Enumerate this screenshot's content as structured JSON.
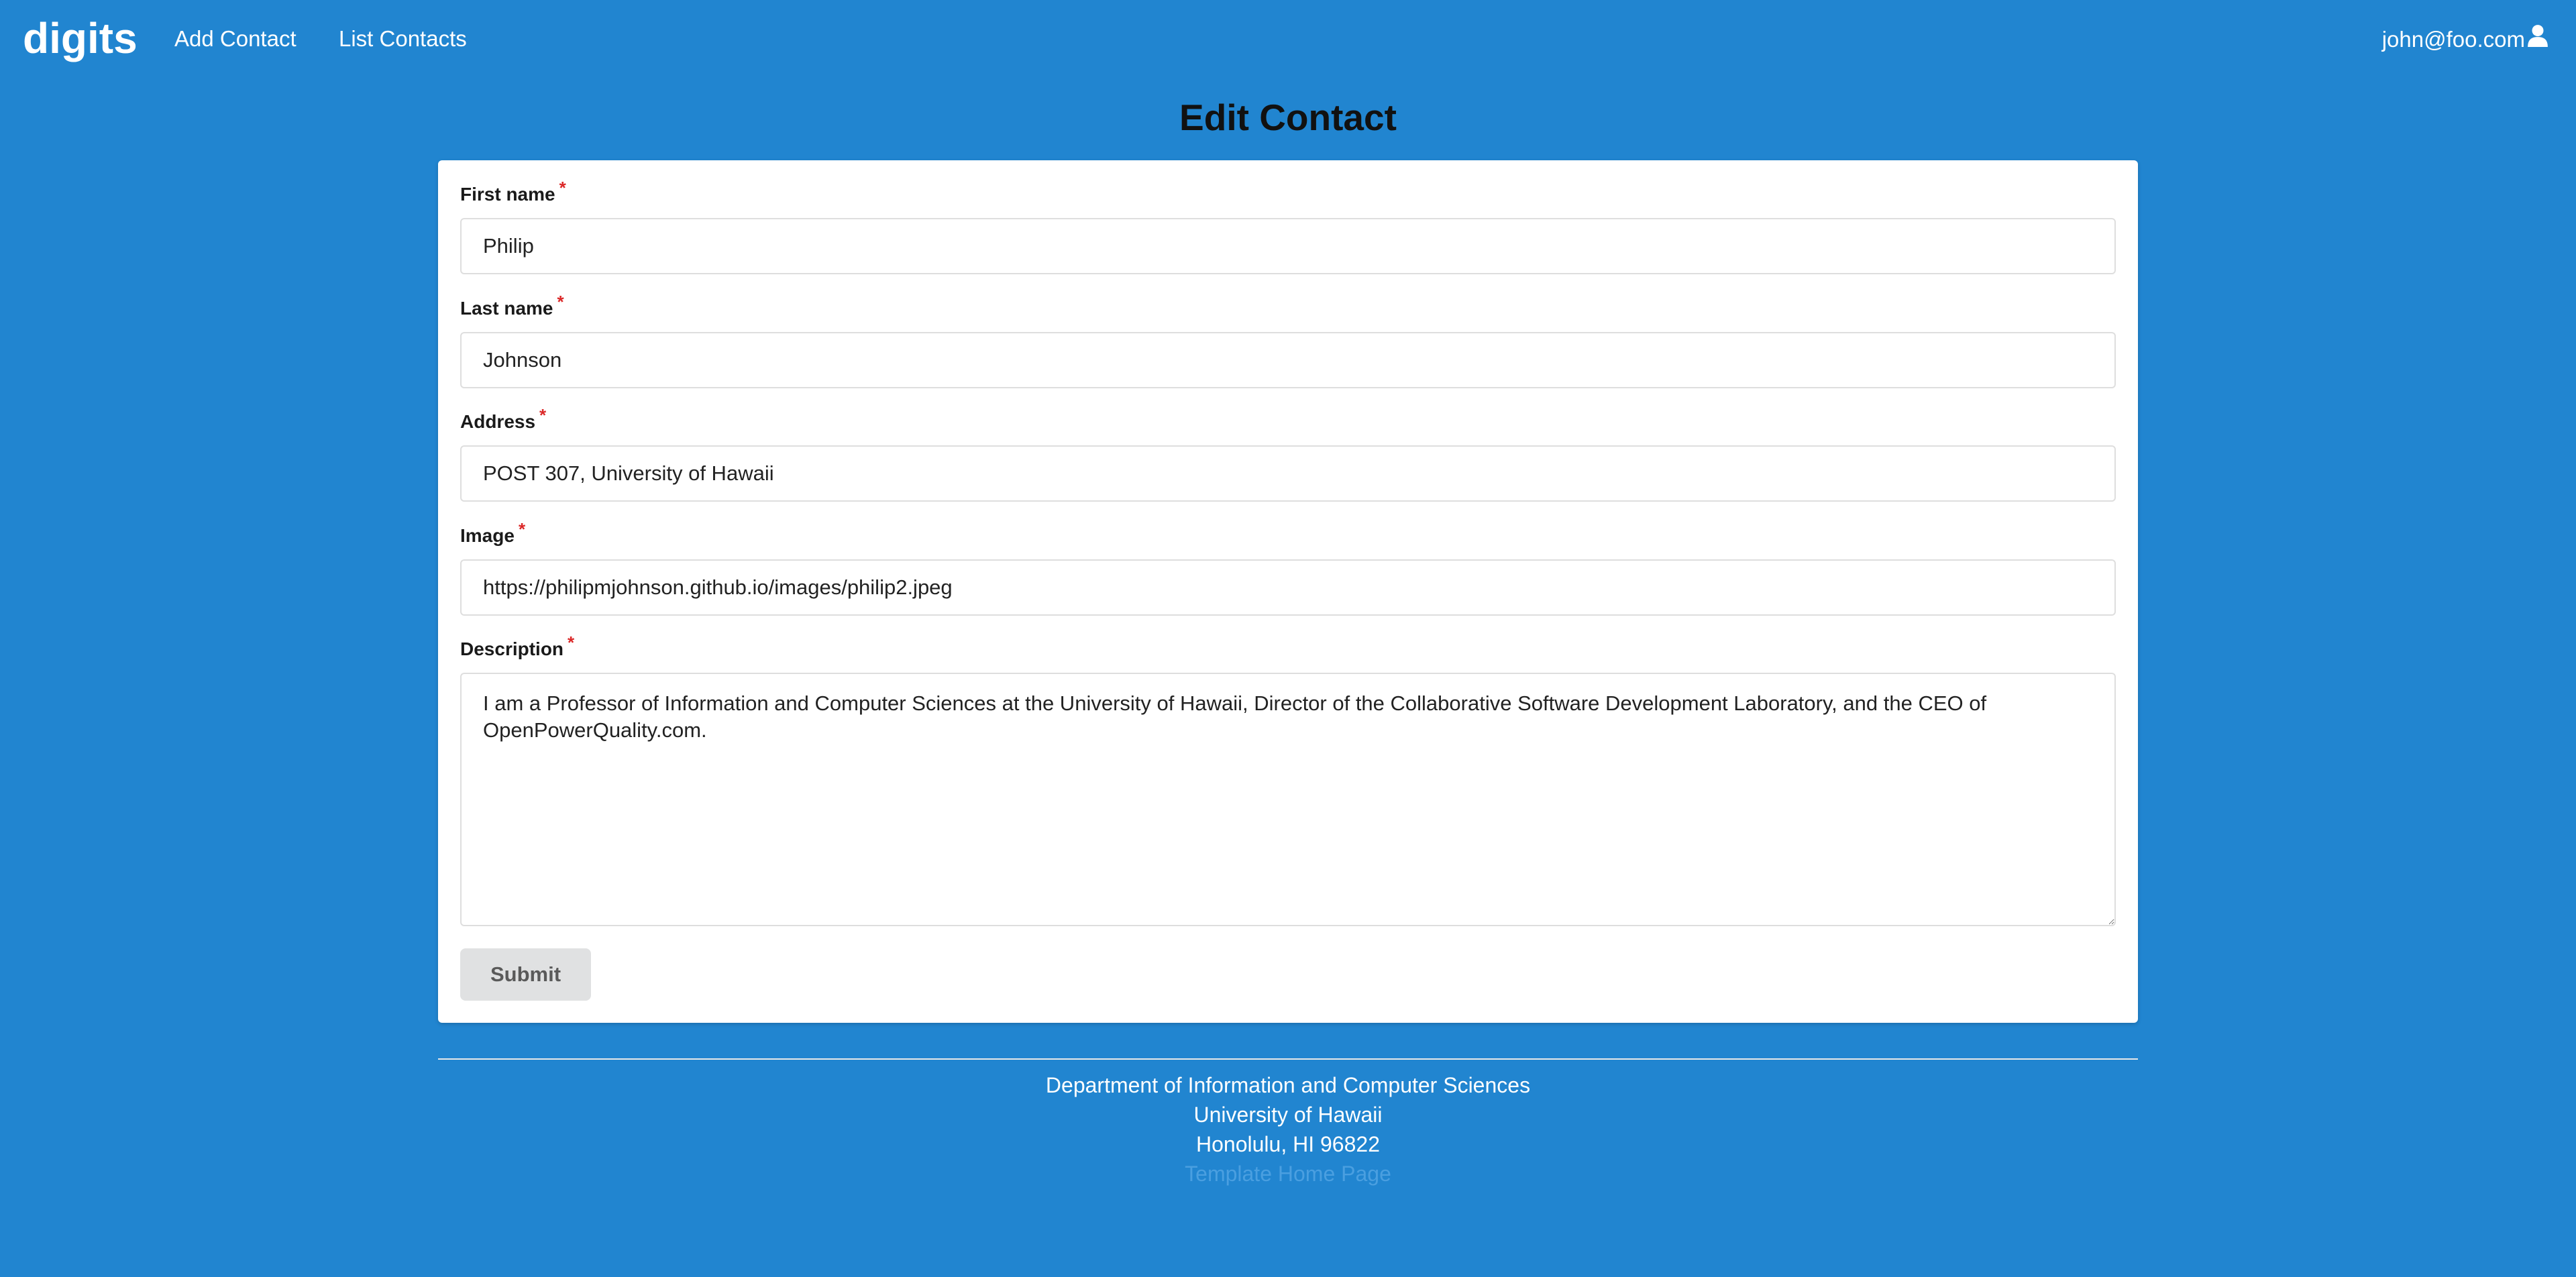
{
  "navbar": {
    "brand": "digits",
    "links": [
      {
        "label": "Add Contact"
      },
      {
        "label": "List Contacts"
      }
    ],
    "user": "john@foo.com"
  },
  "page": {
    "title": "Edit Contact"
  },
  "form": {
    "first_name": {
      "label": "First name",
      "required": "*",
      "value": "Philip"
    },
    "last_name": {
      "label": "Last name",
      "required": "*",
      "value": "Johnson"
    },
    "address": {
      "label": "Address",
      "required": "*",
      "value": "POST 307, University of Hawaii"
    },
    "image": {
      "label": "Image",
      "required": "*",
      "value": "https://philipmjohnson.github.io/images/philip2.jpeg"
    },
    "description": {
      "label": "Description",
      "required": "*",
      "value": "I am a Professor of Information and Computer Sciences at the University of Hawaii, Director of the Collaborative Software Development Laboratory, and the CEO of OpenPowerQuality.com."
    },
    "submit_label": "Submit"
  },
  "footer": {
    "line1": "Department of Information and Computer Sciences",
    "line2": "University of Hawaii",
    "line3": "Honolulu, HI 96822",
    "link": "Template Home Page"
  },
  "colors": {
    "background": "#2185d0",
    "required": "#db2828",
    "button": "#e0e1e2"
  },
  "icons": {
    "user": "user-icon"
  }
}
